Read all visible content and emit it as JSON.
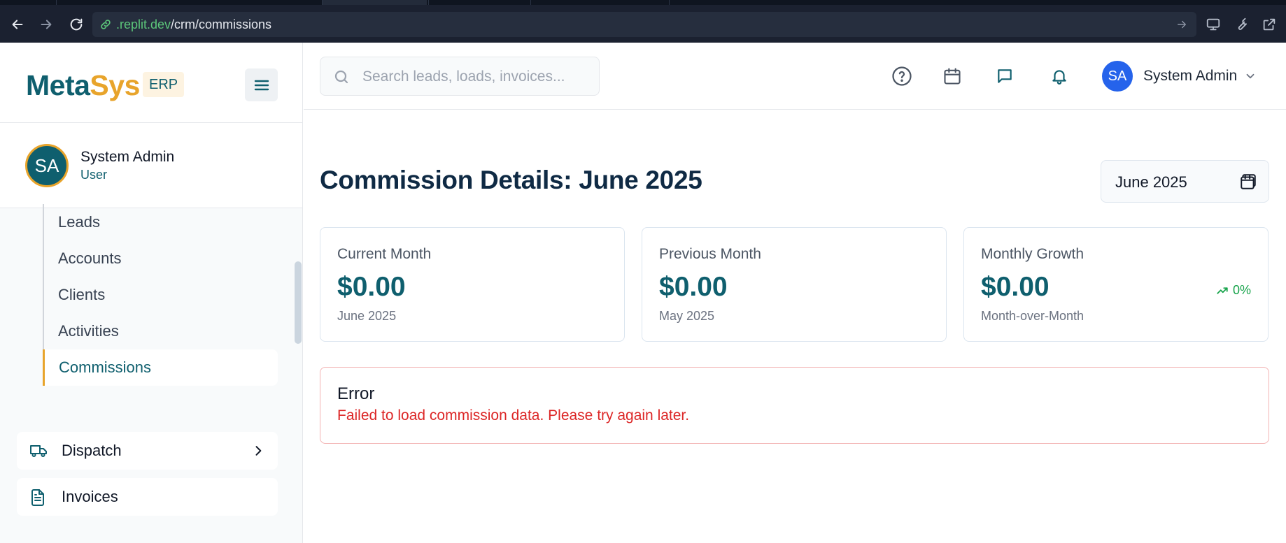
{
  "browser": {
    "url_host": ".replit.dev",
    "url_path": "/crm/commissions"
  },
  "sidebar": {
    "brand": {
      "meta": "Meta",
      "sys": "Sys",
      "badge": "ERP"
    },
    "user": {
      "initials": "SA",
      "name": "System Admin",
      "role": "User"
    },
    "subitems": [
      {
        "label": "Leads"
      },
      {
        "label": "Accounts"
      },
      {
        "label": "Clients"
      },
      {
        "label": "Activities"
      },
      {
        "label": "Commissions"
      }
    ],
    "nav": [
      {
        "label": "Dispatch",
        "icon": "truck-icon"
      },
      {
        "label": "Invoices",
        "icon": "document-icon"
      }
    ]
  },
  "header": {
    "search_placeholder": "Search leads, loads, invoices...",
    "user": {
      "initials": "SA",
      "name": "System Admin"
    }
  },
  "main": {
    "title": "Commission Details: June 2025",
    "month_picker": "June 2025",
    "cards": [
      {
        "title": "Current Month",
        "value": "$0.00",
        "sub": "June 2025"
      },
      {
        "title": "Previous Month",
        "value": "$0.00",
        "sub": "May 2025"
      },
      {
        "title": "Monthly Growth",
        "value": "$0.00",
        "sub": "Month-over-Month",
        "growth": "0%"
      }
    ],
    "error": {
      "title": "Error",
      "message": "Failed to load commission data. Please try again later."
    }
  },
  "colors": {
    "brand_teal": "#0f5f6e",
    "brand_gold": "#e8a42b",
    "error_red": "#dc2626",
    "growth_green": "#16a34a"
  }
}
